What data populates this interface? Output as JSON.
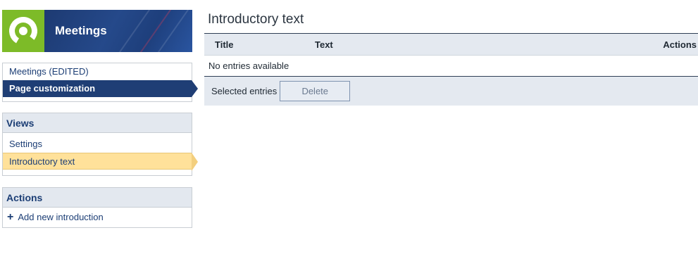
{
  "app": {
    "title": "Meetings"
  },
  "nav": {
    "items": [
      {
        "label": "Meetings (EDITED)"
      },
      {
        "label": "Page customization"
      }
    ]
  },
  "views": {
    "title": "Views",
    "items": [
      {
        "label": "Settings"
      },
      {
        "label": "Introductory text"
      }
    ]
  },
  "actions": {
    "title": "Actions",
    "items": [
      {
        "label": "Add new introduction",
        "icon": "plus-icon"
      }
    ]
  },
  "main": {
    "title": "Introductory text",
    "table": {
      "columns": [
        "Title",
        "Text",
        "Actions"
      ],
      "empty_text": "No entries available"
    },
    "footer": {
      "selected_label": "Selected entries",
      "delete_label": "Delete"
    }
  },
  "colors": {
    "brand_green": "#7dbb28",
    "brand_blue": "#1f3e75",
    "highlight_yellow": "#ffe19a"
  }
}
